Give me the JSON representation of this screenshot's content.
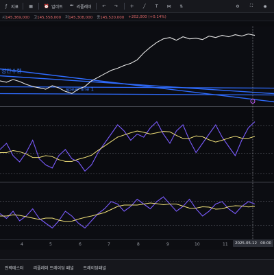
{
  "toolbar": {
    "indicators_label": "지표",
    "alert_label": "얼러트",
    "replay_label": "리플레이"
  },
  "ohlc": {
    "label_o": "시",
    "label_h": "고",
    "label_l": "저",
    "label_c": "종",
    "open": "145,369,000",
    "high": "145,558,000",
    "low": "145,308,000",
    "close": "145,520,000",
    "change": "+202,000 (+0.14%)"
  },
  "annotations": {
    "blue_label_1": "상간수렴",
    "blue_label_2": "spear line 1"
  },
  "x_axis": {
    "ticks": [
      "4",
      "5",
      "6",
      "7",
      "8",
      "9",
      "10",
      "11"
    ],
    "current_date": "2025-05-12",
    "current_time": "00:00"
  },
  "status_tabs": [
    "전략테스터",
    "리플레이 트레이딩 패널",
    "트레이딩패널"
  ],
  "colors": {
    "background": "#0b0c10",
    "price_line": "#e8e8e8",
    "trend_lines": "#2f6cff",
    "oscillator": "#7b5cff",
    "signal": "#f2e27a",
    "down": "#e36a6a"
  },
  "chart_data": [
    {
      "type": "line",
      "name": "price",
      "values": [
        0.3,
        0.28,
        0.32,
        0.29,
        0.25,
        0.22,
        0.2,
        0.18,
        0.23,
        0.2,
        0.15,
        0.12,
        0.18,
        0.22,
        0.3,
        0.35,
        0.4,
        0.45,
        0.48,
        0.52,
        0.55,
        0.6,
        0.7,
        0.78,
        0.85,
        0.9,
        0.92,
        0.88,
        0.93,
        0.9,
        0.91,
        0.89,
        0.94,
        0.92,
        0.95,
        0.93,
        0.96,
        0.94,
        0.97,
        0.95
      ]
    },
    {
      "type": "line",
      "name": "oscillator",
      "values": [
        0.45,
        0.55,
        0.35,
        0.25,
        0.4,
        0.6,
        0.3,
        0.2,
        0.15,
        0.35,
        0.45,
        0.3,
        0.25,
        0.1,
        0.2,
        0.4,
        0.55,
        0.7,
        0.85,
        0.75,
        0.6,
        0.7,
        0.65,
        0.8,
        0.9,
        0.7,
        0.55,
        0.75,
        0.85,
        0.6,
        0.4,
        0.55,
        0.7,
        0.85,
        0.65,
        0.5,
        0.35,
        0.6,
        0.8,
        0.9
      ]
    },
    {
      "type": "line",
      "name": "lower",
      "values": [
        0.5,
        0.4,
        0.55,
        0.35,
        0.45,
        0.6,
        0.4,
        0.3,
        0.2,
        0.35,
        0.55,
        0.45,
        0.3,
        0.2,
        0.35,
        0.5,
        0.6,
        0.75,
        0.7,
        0.55,
        0.65,
        0.8,
        0.7,
        0.6,
        0.75,
        0.85,
        0.7,
        0.55,
        0.65,
        0.8,
        0.6,
        0.45,
        0.55,
        0.7,
        0.75,
        0.6,
        0.5,
        0.65,
        0.75,
        0.7
      ]
    }
  ]
}
